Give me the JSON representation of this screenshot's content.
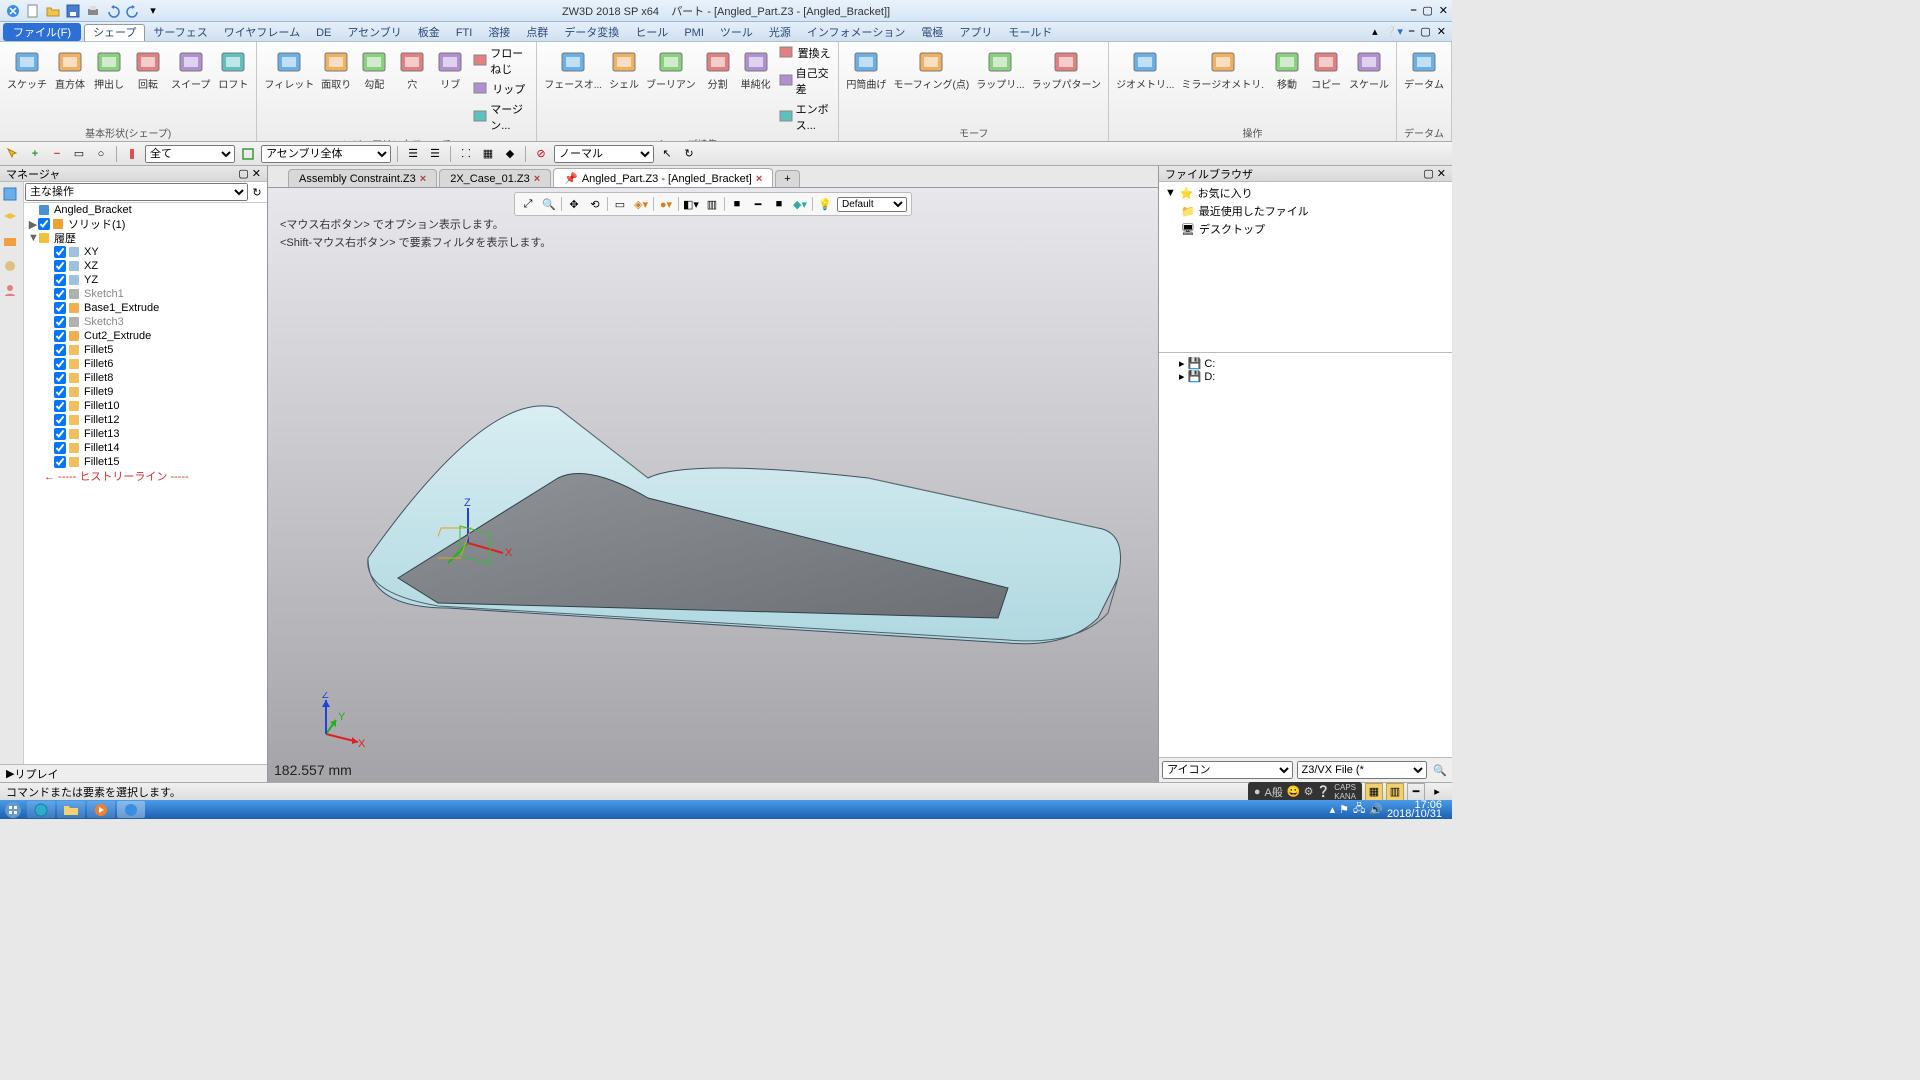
{
  "window": {
    "app": "ZW3D 2018 SP x64",
    "doc": "パート - [Angled_Part.Z3 - [Angled_Bracket]]"
  },
  "menu": {
    "file": "ファイル(F)",
    "tabs": [
      "シェープ",
      "サーフェス",
      "ワイヤフレーム",
      "DE",
      "アセンブリ",
      "板金",
      "FTI",
      "溶接",
      "点群",
      "データ変換",
      "ヒール",
      "PMI",
      "ツール",
      "光源",
      "インフォメーション",
      "電極",
      "アプリ",
      "モールド"
    ],
    "active": 0
  },
  "ribbon": {
    "g1": {
      "label": "基本形状(シェープ)",
      "btns": [
        "スケッチ",
        "直方体",
        "押出し",
        "回転",
        "スイープ",
        "ロフト"
      ]
    },
    "g2": {
      "label": "エンジニアリンクフィーチャ",
      "btns": [
        "フィレット",
        "面取り",
        "勾配",
        "穴",
        "リブ"
      ],
      "small": [
        "フローねじ",
        "リップ",
        "マージン..."
      ]
    },
    "g3": {
      "label": "シェープ編集",
      "btns": [
        "フェースオ...",
        "シェル",
        "ブーリアン",
        "分割",
        "単純化"
      ],
      "small": [
        "置換え",
        "自己交差",
        "エンボス..."
      ]
    },
    "g4": {
      "label": "モーフ",
      "btns": [
        "円筒曲げ",
        "モーフィング(点)",
        "ラップリ...",
        "ラップパターン"
      ]
    },
    "g5": {
      "label": "操作",
      "btns": [
        "ジオメトリ...",
        "ミラージオメトリ.",
        "移動",
        "コピー",
        "スケール"
      ]
    },
    "g6": {
      "label": "データム",
      "btns": [
        "データム"
      ]
    }
  },
  "sub": {
    "filter": "全て",
    "scope": "アセンブリ全体",
    "mode": "ノーマル"
  },
  "manager": {
    "title": "マネージャ",
    "combo": "主な操作",
    "replay": "リプレイ",
    "tree": [
      {
        "d": 0,
        "e": "",
        "c": false,
        "i": "part",
        "t": "Angled_Bracket"
      },
      {
        "d": 0,
        "e": "▶",
        "c": true,
        "i": "solid",
        "t": "ソリッド(1)"
      },
      {
        "d": 0,
        "e": "▼",
        "c": false,
        "i": "hist",
        "t": "履歴"
      },
      {
        "d": 1,
        "e": "",
        "c": true,
        "i": "plane",
        "t": "XY"
      },
      {
        "d": 1,
        "e": "",
        "c": true,
        "i": "plane",
        "t": "XZ"
      },
      {
        "d": 1,
        "e": "",
        "c": true,
        "i": "plane",
        "t": "YZ"
      },
      {
        "d": 1,
        "e": "",
        "c": true,
        "i": "sketch",
        "t": "Sketch1",
        "g": true
      },
      {
        "d": 1,
        "e": "",
        "c": true,
        "i": "feat",
        "t": "Base1_Extrude"
      },
      {
        "d": 1,
        "e": "",
        "c": true,
        "i": "sketch",
        "t": "Sketch3",
        "g": true
      },
      {
        "d": 1,
        "e": "",
        "c": true,
        "i": "feat",
        "t": "Cut2_Extrude"
      },
      {
        "d": 1,
        "e": "",
        "c": true,
        "i": "fillet",
        "t": "Fillet5"
      },
      {
        "d": 1,
        "e": "",
        "c": true,
        "i": "fillet",
        "t": "Fillet6"
      },
      {
        "d": 1,
        "e": "",
        "c": true,
        "i": "fillet",
        "t": "Fillet8"
      },
      {
        "d": 1,
        "e": "",
        "c": true,
        "i": "fillet",
        "t": "Fillet9"
      },
      {
        "d": 1,
        "e": "",
        "c": true,
        "i": "fillet",
        "t": "Fillet10"
      },
      {
        "d": 1,
        "e": "",
        "c": true,
        "i": "fillet",
        "t": "Fillet12"
      },
      {
        "d": 1,
        "e": "",
        "c": true,
        "i": "fillet",
        "t": "Fillet13"
      },
      {
        "d": 1,
        "e": "",
        "c": true,
        "i": "fillet",
        "t": "Fillet14"
      },
      {
        "d": 1,
        "e": "",
        "c": true,
        "i": "fillet",
        "t": "Fillet15"
      },
      {
        "d": 1,
        "e": "",
        "c": false,
        "i": "line",
        "t": "----- ヒストリーライン -----",
        "r": true
      }
    ]
  },
  "doctabs": [
    {
      "t": "Assembly Constraint.Z3",
      "a": false
    },
    {
      "t": "2X_Case_01.Z3",
      "a": false
    },
    {
      "t": "Angled_Part.Z3 - [Angled_Bracket]",
      "a": true,
      "pin": true
    }
  ],
  "viewport": {
    "hint1": "<マウス右ボタン> でオプション表示します。",
    "hint2": "<Shift-マウス右ボタン> で要素フィルタを表示します。",
    "coord": "182.557 mm",
    "layer": "Default"
  },
  "browser": {
    "title": "ファイルブラウザ",
    "items": [
      "お気に入り",
      "最近使用したファイル",
      "デスクトップ"
    ],
    "drives": [
      "C:",
      "D:"
    ],
    "iconLabel": "アイコン",
    "filter": "Z3/VX File (*"
  },
  "status": {
    "msg": "コマンドまたは要素を選択します。",
    "ime": "A般"
  },
  "taskbar": {
    "time": "17:06",
    "date": "2018/10/31"
  }
}
